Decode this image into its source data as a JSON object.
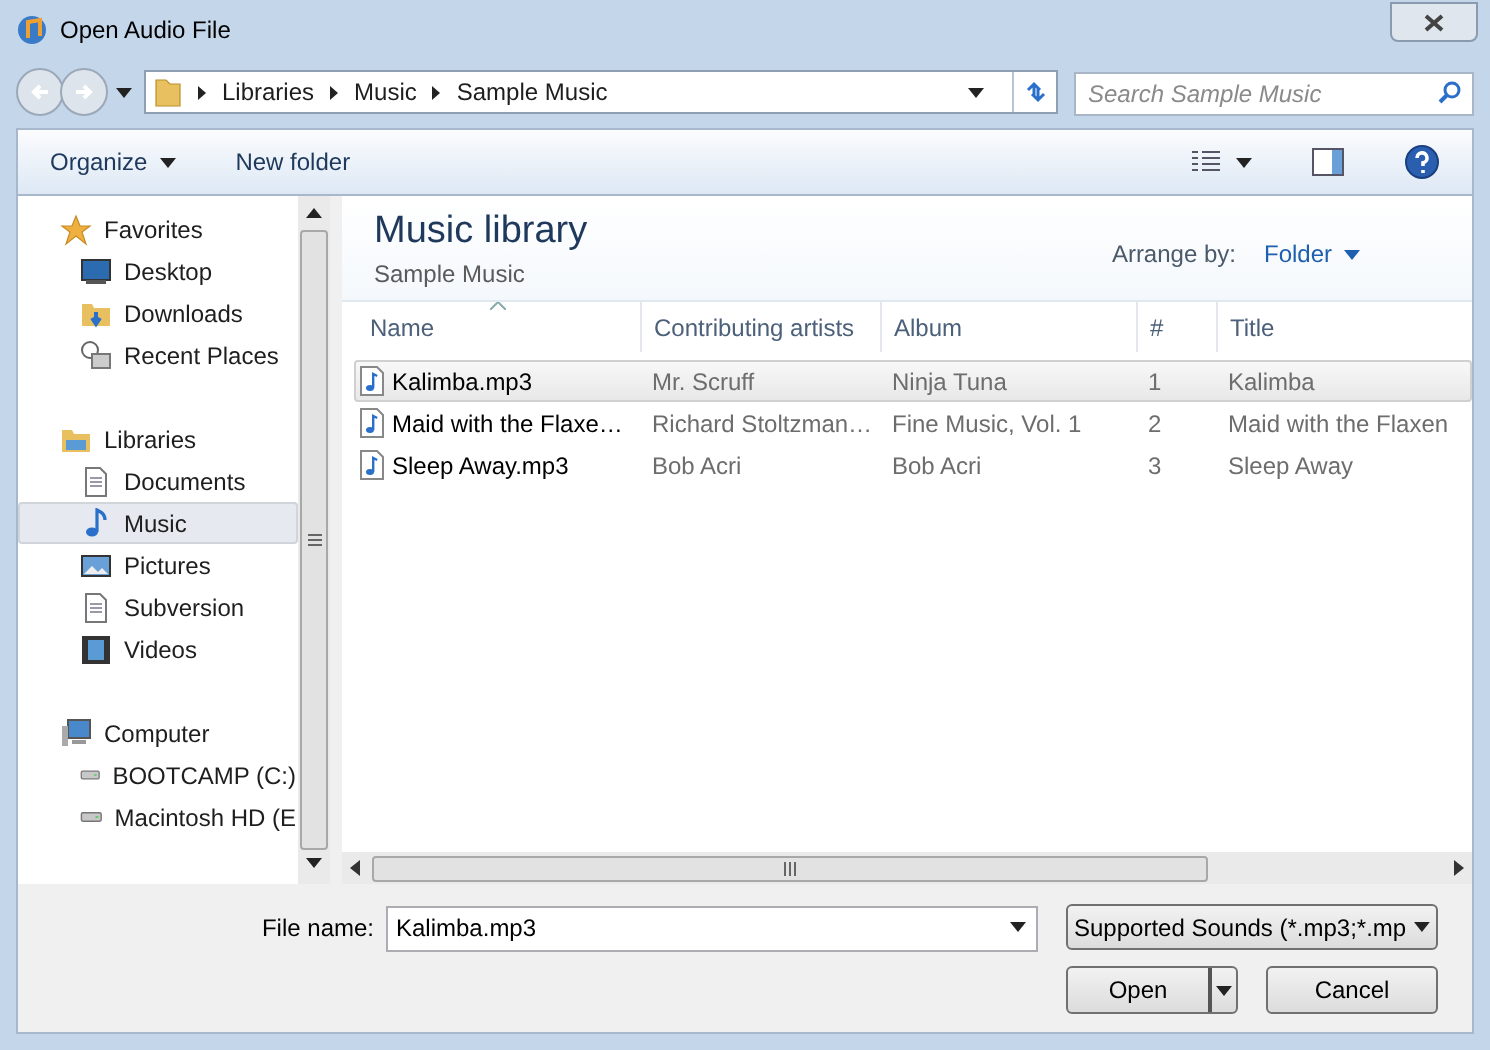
{
  "window": {
    "title": "Open Audio File"
  },
  "address": {
    "crumbs": [
      "Libraries",
      "Music",
      "Sample Music"
    ]
  },
  "search": {
    "placeholder": "Search Sample Music"
  },
  "toolbar": {
    "organize": "Organize",
    "new_folder": "New folder"
  },
  "sidebar": {
    "groups": [
      {
        "label": "Favorites",
        "kind": "favorites",
        "children": [
          {
            "label": "Desktop",
            "kind": "desktop",
            "selected": false
          },
          {
            "label": "Downloads",
            "kind": "downloads",
            "selected": false
          },
          {
            "label": "Recent Places",
            "kind": "recent",
            "selected": false
          }
        ]
      },
      {
        "label": "Libraries",
        "kind": "libraries",
        "children": [
          {
            "label": "Documents",
            "kind": "document",
            "selected": false
          },
          {
            "label": "Music",
            "kind": "music",
            "selected": true
          },
          {
            "label": "Pictures",
            "kind": "pictures",
            "selected": false
          },
          {
            "label": "Subversion",
            "kind": "document",
            "selected": false
          },
          {
            "label": "Videos",
            "kind": "videos",
            "selected": false
          }
        ]
      },
      {
        "label": "Computer",
        "kind": "computer",
        "children": [
          {
            "label": "BOOTCAMP (C:)",
            "kind": "drive",
            "selected": false
          },
          {
            "label": "Macintosh HD (E",
            "kind": "drive",
            "selected": false
          }
        ]
      }
    ]
  },
  "library": {
    "title": "Music library",
    "subtitle": "Sample Music",
    "arrange_label": "Arrange by:",
    "arrange_value": "Folder"
  },
  "table": {
    "columns": [
      "Name",
      "Contributing artists",
      "Album",
      "#",
      "Title"
    ],
    "rows": [
      {
        "selected": true,
        "cells": [
          "Kalimba.mp3",
          "Mr. Scruff",
          "Ninja Tuna",
          "1",
          "Kalimba"
        ]
      },
      {
        "selected": false,
        "cells": [
          "Maid with the Flaxe…",
          "Richard Stoltzman…",
          "Fine Music, Vol. 1",
          "2",
          "Maid with the Flaxen"
        ]
      },
      {
        "selected": false,
        "cells": [
          "Sleep Away.mp3",
          "Bob Acri",
          "Bob Acri",
          "3",
          "Sleep Away"
        ]
      }
    ]
  },
  "footer": {
    "file_name_label": "File name:",
    "file_name": "Kalimba.mp3",
    "file_type": "Supported Sounds (*.mp3;*.mp",
    "open": "Open",
    "cancel": "Cancel"
  }
}
